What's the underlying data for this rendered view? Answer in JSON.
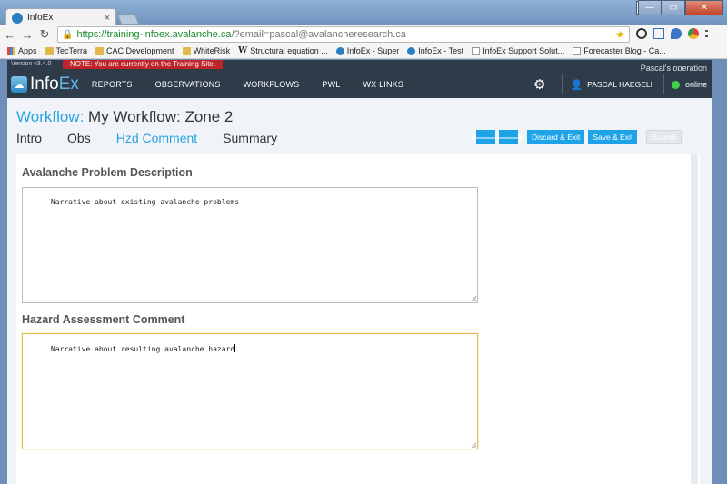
{
  "browser": {
    "tab_title": "InfoEx",
    "tab_close": "×",
    "url_main": "https://training-infoex.avalanche.ca",
    "url_rest": "/?email=pascal@avalancheresearch.ca",
    "bookmarks": [
      {
        "label": "Apps",
        "icon": "apps-icon"
      },
      {
        "label": "TecTerra",
        "icon": "folder-icon"
      },
      {
        "label": "CAC Development",
        "icon": "folder-icon"
      },
      {
        "label": "WhiteRisk",
        "icon": "folder-icon"
      },
      {
        "label": "Structural equation ...",
        "icon": "wikipedia-icon"
      },
      {
        "label": "InfoEx - Super",
        "icon": "infoex-icon"
      },
      {
        "label": "InfoEx - Test",
        "icon": "infoex-icon"
      },
      {
        "label": "InfoEx Support Solut...",
        "icon": "document-icon"
      },
      {
        "label": "Forecaster Blog - Ca...",
        "icon": "document-icon"
      }
    ]
  },
  "app": {
    "version": "Version v3.4.0",
    "training_notice": "NOTE: You are currently on the Training Site.",
    "operation": "Pascal's operation",
    "logo_a": "Info",
    "logo_b": "Ex",
    "nav": [
      "REPORTS",
      "OBSERVATIONS",
      "WORKFLOWS",
      "PWL",
      "WX LINKS"
    ],
    "user": "PASCAL HAEGELI",
    "status": "online"
  },
  "workflow": {
    "label": "Workflow:",
    "name": "My Workflow: Zone 2",
    "tabs": [
      "Intro",
      "Obs",
      "Hzd Comment",
      "Summary"
    ],
    "active_tab": "Hzd Comment",
    "buttons": {
      "prev": "🡐",
      "next": "🡒",
      "discard": "Discard & Exit",
      "save": "Save & Exit",
      "submit": "Submit"
    }
  },
  "form": {
    "avalanche_problem": {
      "heading": "Avalanche Problem Description",
      "value": "Narrative about existing avalanche problems"
    },
    "hazard_assessment": {
      "heading": "Hazard Assessment Comment",
      "value": "Narrative about resulting avalanche hazard"
    }
  },
  "colors": {
    "accent": "#29a3e0",
    "navbar": "#2e3c4a",
    "training_banner": "#c0242a",
    "online": "#3fd147"
  }
}
